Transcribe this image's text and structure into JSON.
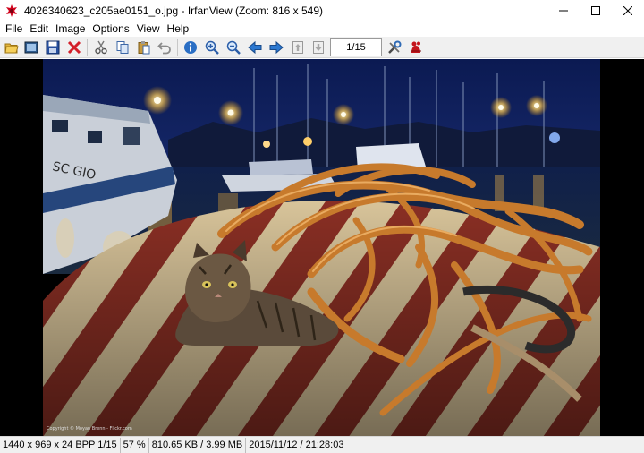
{
  "window": {
    "title": "4026340623_c205ae0151_o.jpg - IrfanView (Zoom: 816 x 549)"
  },
  "menu": [
    "File",
    "Edit",
    "Image",
    "Options",
    "View",
    "Help"
  ],
  "toolbar": {
    "page_indicator": "1/15",
    "icons": [
      "open-folder-icon",
      "thumbnails-icon",
      "save-icon",
      "delete-icon",
      "cut-icon",
      "copy-icon",
      "paste-icon",
      "undo-icon",
      "info-icon",
      "zoom-in-icon",
      "zoom-out-icon",
      "previous-icon",
      "next-icon",
      "first-page-icon",
      "next-page-icon",
      "settings-icon",
      "irfanview-logo-icon"
    ]
  },
  "image": {
    "copyright": "Copyright © Moyan Brenn - Flickr.com"
  },
  "status": {
    "dimensions": "1440 x 969 x 24 BPP 1/15",
    "zoom": "57 %",
    "filesize": "810.65 KB / 3.99 MB",
    "datetime": "2015/11/12 / 21:28:03"
  }
}
